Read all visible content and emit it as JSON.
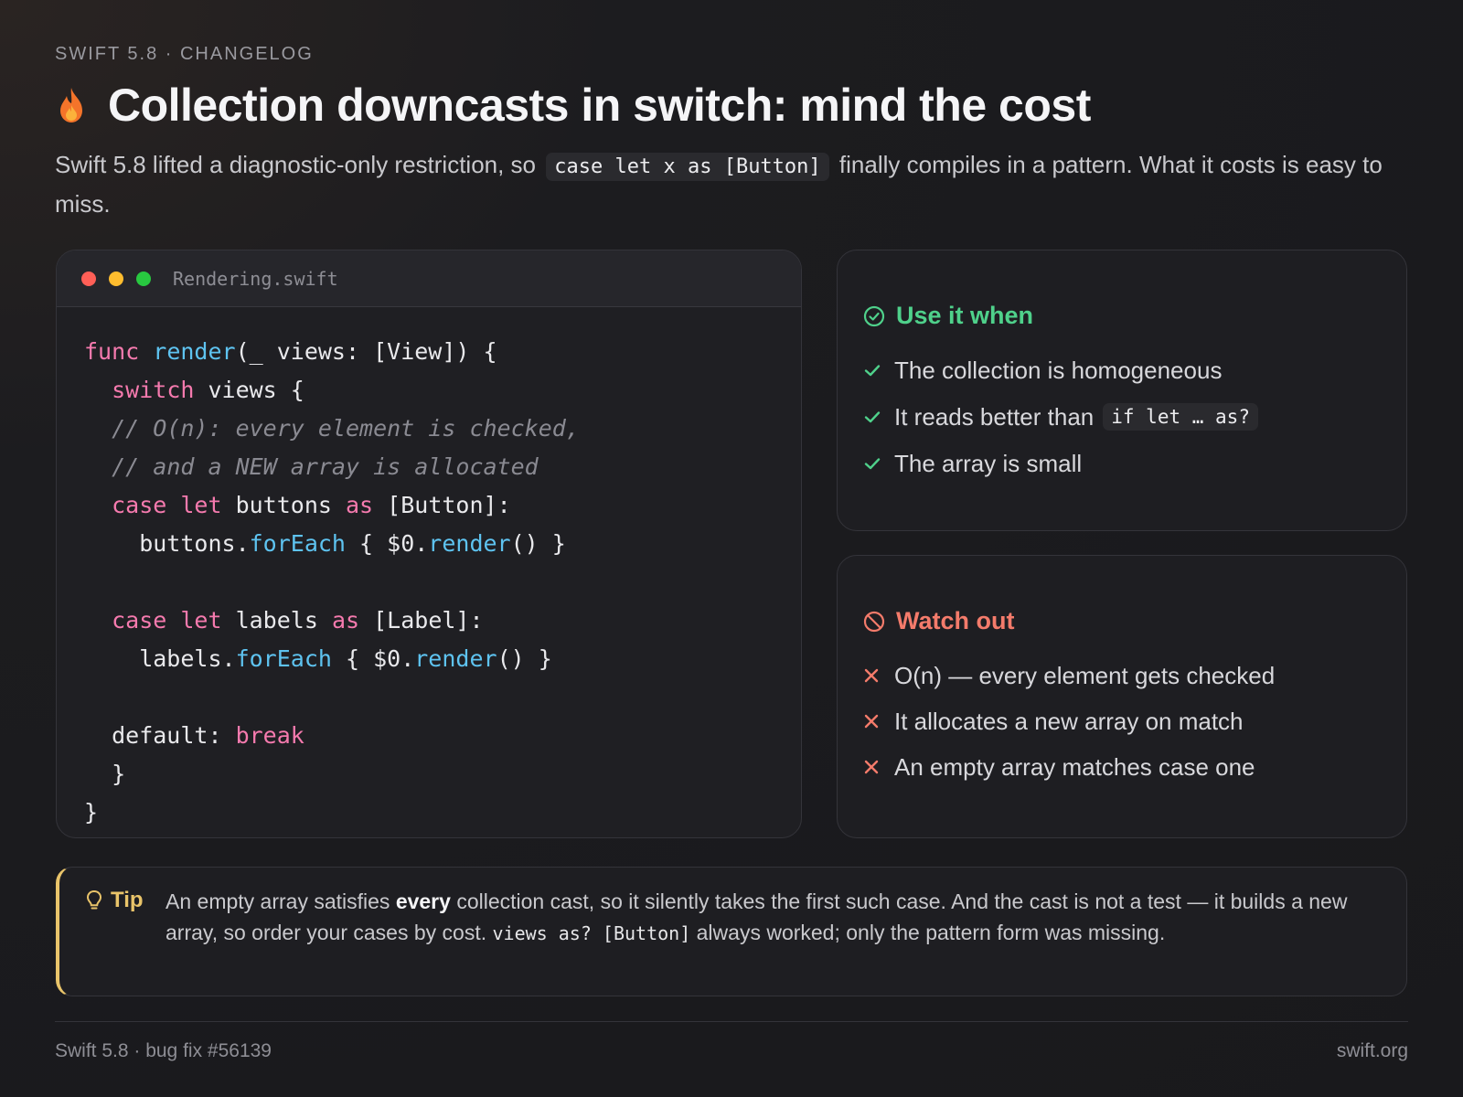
{
  "header": {
    "eyebrow": "SWIFT 5.8 · CHANGELOG",
    "title": "Collection downcasts in switch: mind the cost",
    "intro_before": "Swift 5.8 lifted a diagnostic-only restriction, so",
    "intro_code": "case let x as [Button]",
    "intro_after": "finally compiles in a pattern. What it costs is easy to miss."
  },
  "code_window": {
    "filename": "Rendering.swift",
    "lines": [
      [
        {
          "t": "kw",
          "v": "func "
        },
        {
          "t": "fn",
          "v": "render"
        },
        {
          "t": "",
          "v": "(_ views: [View]) {"
        }
      ],
      [
        {
          "t": "",
          "v": "  "
        },
        {
          "t": "kw",
          "v": "switch"
        },
        {
          "t": "",
          "v": " views {"
        }
      ],
      [
        {
          "t": "",
          "v": "  "
        },
        {
          "t": "cm",
          "v": "// O(n): every element is checked,"
        }
      ],
      [
        {
          "t": "",
          "v": "  "
        },
        {
          "t": "cm",
          "v": "// and a NEW array is allocated"
        }
      ],
      [
        {
          "t": "",
          "v": "  "
        },
        {
          "t": "kw",
          "v": "case let"
        },
        {
          "t": "",
          "v": " buttons "
        },
        {
          "t": "kw",
          "v": "as"
        },
        {
          "t": "",
          "v": " [Button]:"
        }
      ],
      [
        {
          "t": "",
          "v": "    buttons."
        },
        {
          "t": "fn",
          "v": "forEach"
        },
        {
          "t": "",
          "v": " { $0."
        },
        {
          "t": "fn",
          "v": "render"
        },
        {
          "t": "",
          "v": "() }"
        }
      ],
      [],
      [
        {
          "t": "",
          "v": "  "
        },
        {
          "t": "kw",
          "v": "case let"
        },
        {
          "t": "",
          "v": " labels "
        },
        {
          "t": "kw",
          "v": "as"
        },
        {
          "t": "",
          "v": " [Label]:"
        }
      ],
      [
        {
          "t": "",
          "v": "    labels."
        },
        {
          "t": "fn",
          "v": "forEach"
        },
        {
          "t": "",
          "v": " { $0."
        },
        {
          "t": "fn",
          "v": "render"
        },
        {
          "t": "",
          "v": "() }"
        }
      ],
      [],
      [
        {
          "t": "",
          "v": "  default: "
        },
        {
          "t": "kw",
          "v": "break"
        }
      ],
      [
        {
          "t": "",
          "v": "  }"
        }
      ],
      [
        {
          "t": "",
          "v": "}"
        }
      ]
    ]
  },
  "use_card": {
    "heading": "Use it when",
    "item1": "The collection is homogeneous",
    "item2_text": "It reads better than",
    "item2_code": "if let … as?",
    "item3": "The array is small"
  },
  "watch_card": {
    "heading": "Watch out",
    "items": [
      "O(n) — every element gets checked",
      "It allocates a new array on match",
      "An empty array matches case one"
    ]
  },
  "tip": {
    "label": "Tip",
    "text_a": "An empty array satisfies ",
    "text_bold": "every",
    "text_b": " collection cast, so it silently takes the first such case. And the cast is not a test — it builds a new array, so order your cases by cost. ",
    "text_code": "views as? [Button]",
    "text_c": " always worked; only the pattern form was missing."
  },
  "footer": {
    "left": "Swift 5.8 · bug fix #56139",
    "right": "swift.org"
  },
  "colors": {
    "keyword": "#f57aae",
    "function": "#5ec3f0",
    "comment": "#8a8a92",
    "good": "#4fd18b",
    "bad": "#f47b6b",
    "tip": "#e9c46a"
  }
}
